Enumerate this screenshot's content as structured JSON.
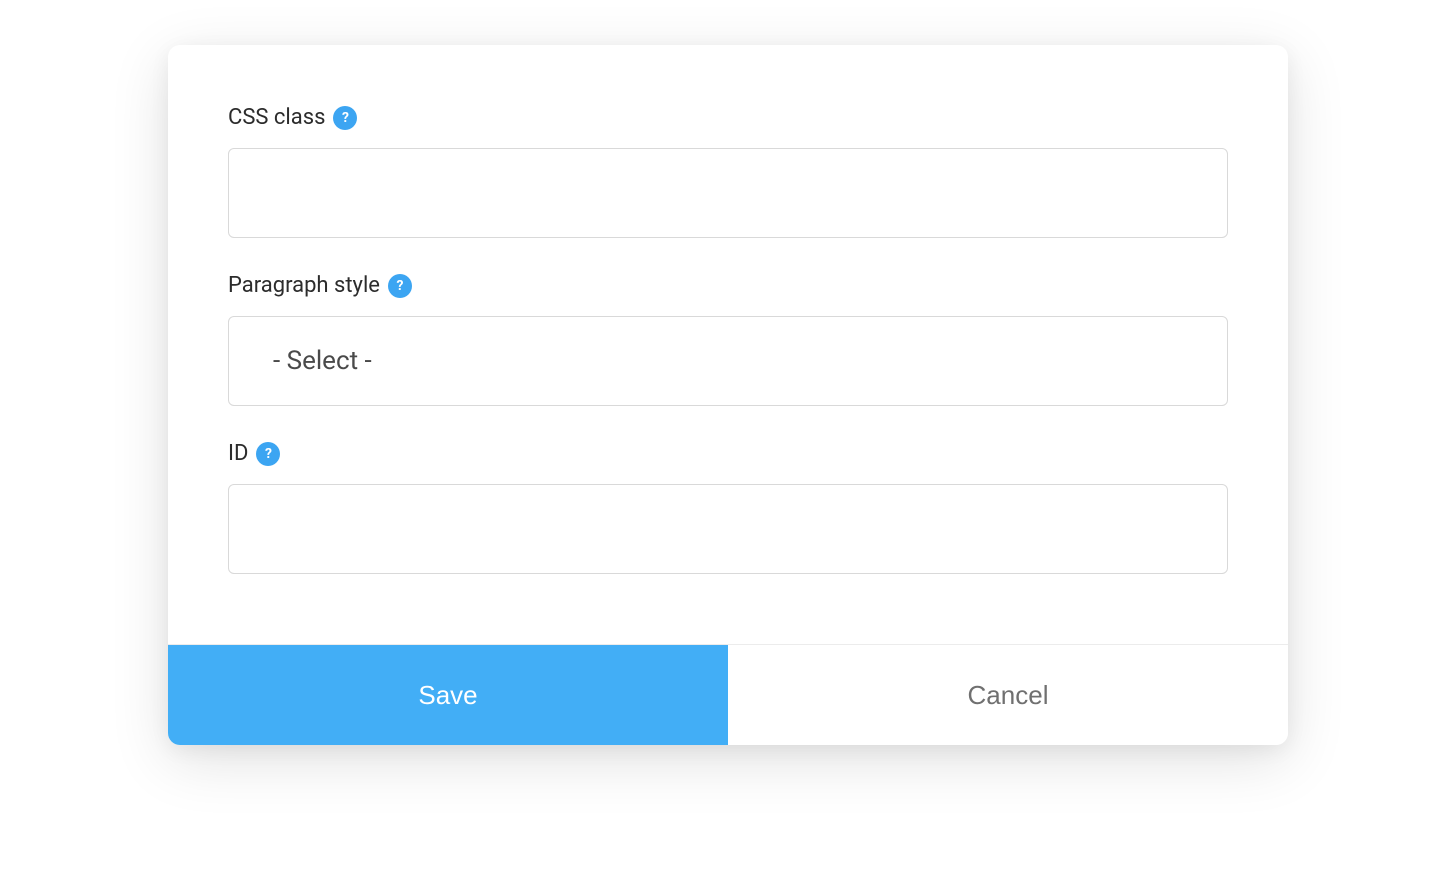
{
  "form": {
    "css_class": {
      "label": "CSS class",
      "value": ""
    },
    "paragraph_style": {
      "label": "Paragraph style",
      "selected": "- Select -"
    },
    "id": {
      "label": "ID",
      "value": ""
    }
  },
  "buttons": {
    "save": "Save",
    "cancel": "Cancel"
  },
  "help_icon_char": "?"
}
